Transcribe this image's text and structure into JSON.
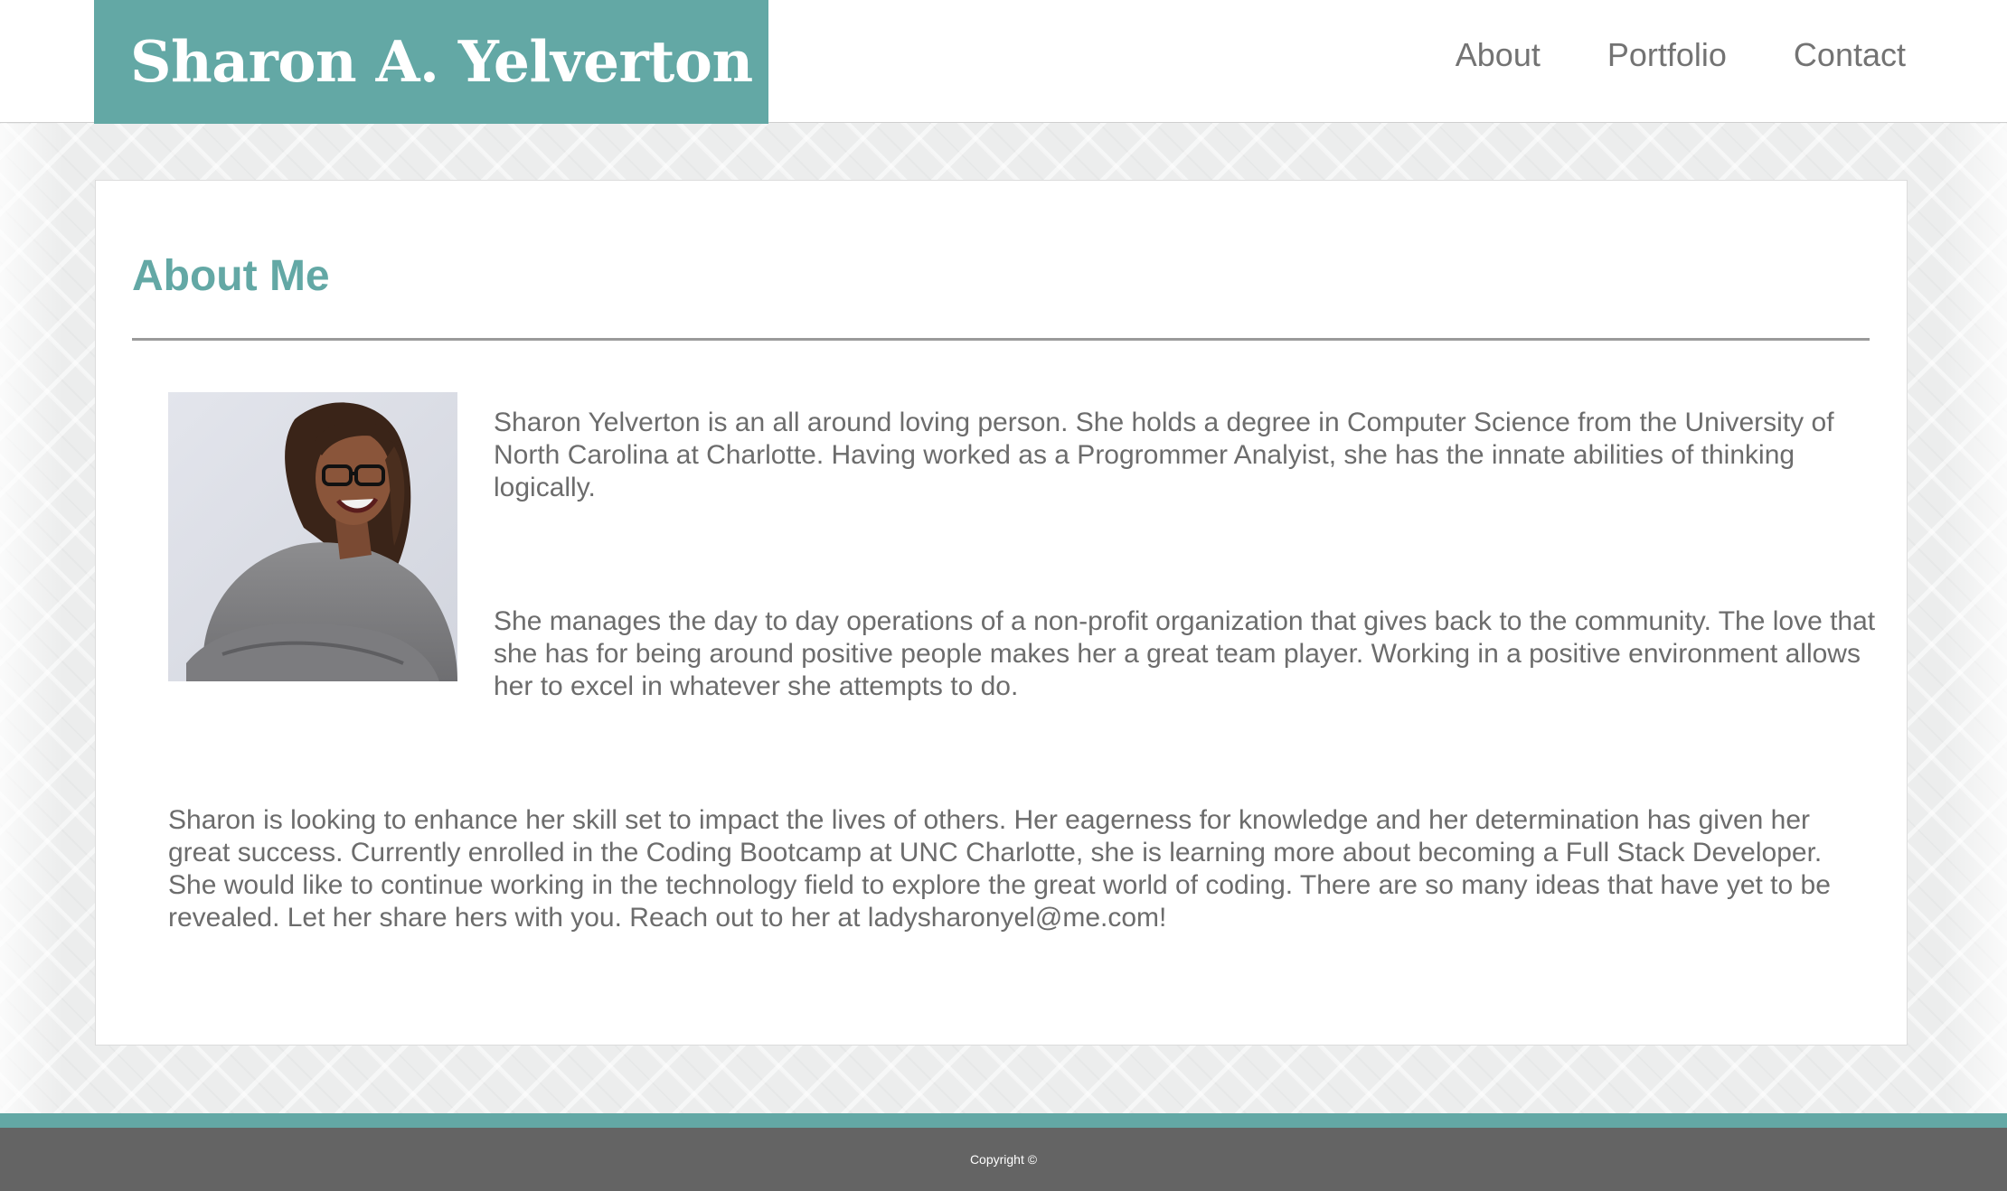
{
  "header": {
    "site_title": "Sharon A. Yelverton",
    "nav": [
      {
        "label": "About"
      },
      {
        "label": "Portfolio"
      },
      {
        "label": "Contact"
      }
    ]
  },
  "about": {
    "heading": "About Me",
    "photo_alt": "Portrait photo",
    "paragraphs": [
      "Sharon Yelverton is an all around loving person. She holds a degree in Computer Science from the University of North Carolina at Charlotte. Having worked as a Progrommer Analyist, she has the innate abilities of thinking logically.",
      "She manages the day to day operations of a non-profit organization that gives back to the community. The love that she has for being around positive people makes her a great team player. Working in a positive environment allows her to excel in whatever she attempts to do.",
      "Sharon is looking to enhance her skill set to impact the lives of others. Her eagerness for knowledge and her determination has given her great success. Currently enrolled in the Coding Bootcamp at UNC Charlotte, she is learning more about becoming a Full Stack Developer. She would like to continue working in the technology field to explore the great world of coding. There are so many ideas that have yet to be revealed. Let her share hers with you. Reach out to her at ladysharonyel@me.com!"
    ]
  },
  "footer": {
    "copyright": "Copyright ©"
  },
  "colors": {
    "accent": "#63a8a5",
    "footer_bg": "#646464",
    "text": "#6c6c6c",
    "nav_text": "#737373"
  }
}
